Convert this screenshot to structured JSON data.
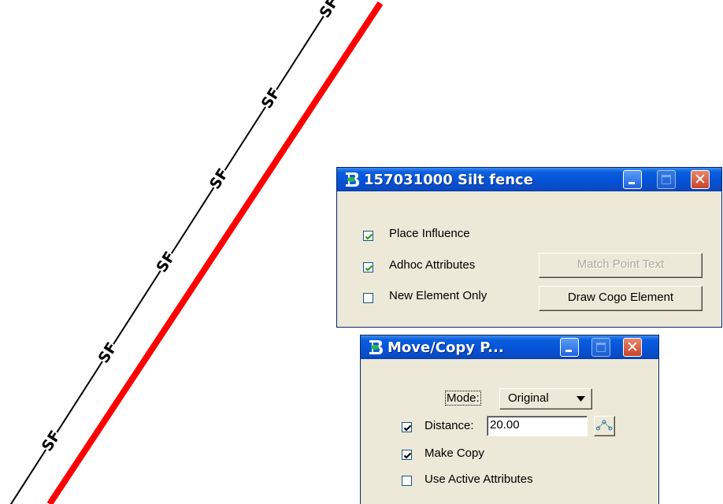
{
  "drawing": {
    "line_label": "SF",
    "red_line_color": "#ff0000"
  },
  "silt_fence_window": {
    "title": "157031000 Silt fence",
    "icon": "bentley-b-icon",
    "place_influence": {
      "label": "Place Influence",
      "checked": true
    },
    "adhoc_attributes": {
      "label": "Adhoc Attributes",
      "checked": true
    },
    "new_element_only": {
      "label": "New Element Only",
      "checked": false
    },
    "match_point_text_label": "Match Point Text",
    "draw_cogo_element_label": "Draw Cogo Element"
  },
  "move_copy_window": {
    "title": "Move/Copy P...",
    "icon": "bentley-b-icon",
    "mode_label": "Mode:",
    "mode_value": "Original",
    "distance": {
      "label": "Distance:",
      "checked": true,
      "value": "20.00"
    },
    "make_copy": {
      "label": "Make Copy",
      "checked": true
    },
    "use_active_attributes": {
      "label": "Use Active Attributes",
      "checked": false
    }
  }
}
